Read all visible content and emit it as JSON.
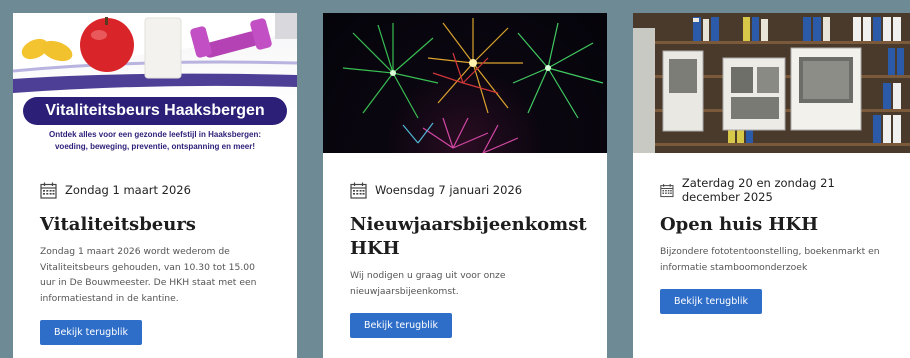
{
  "cards": [
    {
      "banner_title": "Vitaliteitsbeurs Haaksbergen",
      "banner_sub_1": "Ontdek alles voor een gezonde leefstijl in Haaksbergen:",
      "banner_sub_2": "voeding, beweging, preventie, ontspanning en meer!",
      "date": "Zondag 1 maart 2026",
      "title": "Vitaliteitsbeurs",
      "description": "Zondag 1 maart 2026 wordt wederom de Vitaliteitsbeurs gehouden, van 10.30 tot 15.00 uur in De Bouwmeester. De HKH staat met een informatiestand in de kantine.",
      "button": "Bekijk terugblik"
    },
    {
      "date": "Woensdag 7 januari 2026",
      "title": "Nieuwjaarsbijeenkomst HKH",
      "description": "Wij nodigen u graag uit voor onze nieuwjaarsbijeenkomst.",
      "button": "Bekijk terugblik"
    },
    {
      "date": "Zaterdag 20 en zondag 21 december 2025",
      "title": "Open huis HKH",
      "description": "Bijzondere fototentoonstelling, boekenmarkt en informatie stamboomonderzoek",
      "button": "Bekijk terugblik"
    }
  ],
  "colors": {
    "background": "#6e8a94",
    "button": "#2f6ec8",
    "banner_navy": "#2c1f78"
  },
  "icons": {
    "date": "calendar-icon"
  }
}
